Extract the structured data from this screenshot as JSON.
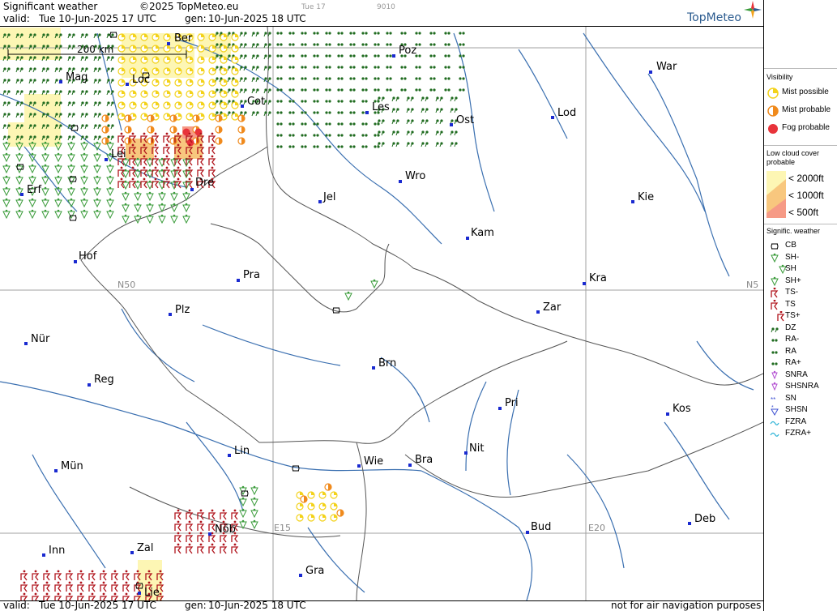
{
  "header": {
    "title": "Significant weather",
    "copyright": "©2025 TopMeteo.eu",
    "valid_label": "valid:",
    "valid_value": "Tue  10-Jun-2025  17 UTC",
    "gen_label": "gen:",
    "gen_value": "10-Jun-2025 18 UTC",
    "ghost_day": "Tue 17",
    "ghost_code": "9010",
    "logo": "TopMeteo"
  },
  "footer": {
    "valid_label": "valid:",
    "valid_value": "Tue  10-Jun-2025  17 UTC",
    "gen_label": "gen:",
    "gen_value": "10-Jun-2025 18 UTC",
    "disclaimer": "not for air navigation purposes"
  },
  "map": {
    "scale_label": "200 km",
    "grid_labels": {
      "n50": "N50",
      "n50_right": "N5",
      "e15": "E15",
      "e20": "E20"
    },
    "cities": [
      {
        "name": "Ber"
      },
      {
        "name": "Poz"
      },
      {
        "name": "War"
      },
      {
        "name": "Mag"
      },
      {
        "name": "Loc"
      },
      {
        "name": "Cot"
      },
      {
        "name": "Les"
      },
      {
        "name": "Ost"
      },
      {
        "name": "Lod"
      },
      {
        "name": "Lei"
      },
      {
        "name": "Erf"
      },
      {
        "name": "Dre"
      },
      {
        "name": "Jel"
      },
      {
        "name": "Wro"
      },
      {
        "name": "Kie"
      },
      {
        "name": "Kam"
      },
      {
        "name": "Hof"
      },
      {
        "name": "Pra"
      },
      {
        "name": "Kra"
      },
      {
        "name": "Zar"
      },
      {
        "name": "Plz"
      },
      {
        "name": "Nür"
      },
      {
        "name": "Brn"
      },
      {
        "name": "Reg"
      },
      {
        "name": "Pri"
      },
      {
        "name": "Kos"
      },
      {
        "name": "Nit"
      },
      {
        "name": "Lin"
      },
      {
        "name": "Wie"
      },
      {
        "name": "Bra"
      },
      {
        "name": "Mün"
      },
      {
        "name": "Nöb"
      },
      {
        "name": "Bud"
      },
      {
        "name": "Deb"
      },
      {
        "name": "Inn"
      },
      {
        "name": "Zal"
      },
      {
        "name": "Gra"
      },
      {
        "name": "Lie"
      }
    ]
  },
  "legend": {
    "visibility_title": "Visibility",
    "visibility": [
      {
        "label": "Mist possible",
        "color": "#f3d21a"
      },
      {
        "label": "Mist probable",
        "color": "#f08a1c"
      },
      {
        "label": "Fog probable",
        "color": "#e8333a"
      }
    ],
    "lowcloud_title_1": "Low cloud cover",
    "lowcloud_title_2": "probable",
    "lowcloud": [
      {
        "label": "< 2000ft",
        "color": "#fdf6b4"
      },
      {
        "label": "< 1000ft",
        "color": "#f8c77e"
      },
      {
        "label": "<   500ft",
        "color": "#f69a86"
      }
    ],
    "sigwx_title": "Signific. weather",
    "sigwx": [
      {
        "label": "CB",
        "icon": "cb-icon"
      },
      {
        "label": "SH-",
        "icon": "shower-light-icon"
      },
      {
        "label": "SH",
        "icon": "shower-icon"
      },
      {
        "label": "SH+",
        "icon": "shower-heavy-icon"
      },
      {
        "label": "TS-",
        "icon": "thunderstorm-light-icon"
      },
      {
        "label": "TS",
        "icon": "thunderstorm-icon"
      },
      {
        "label": "TS+",
        "icon": "thunderstorm-heavy-icon"
      },
      {
        "label": "DZ",
        "icon": "drizzle-icon"
      },
      {
        "label": "RA-",
        "icon": "rain-light-icon"
      },
      {
        "label": "RA",
        "icon": "rain-icon"
      },
      {
        "label": "RA+",
        "icon": "rain-heavy-icon"
      },
      {
        "label": "SNRA",
        "icon": "sleet-icon"
      },
      {
        "label": "SHSNRA",
        "icon": "sleet-shower-icon"
      },
      {
        "label": "SN",
        "icon": "snow-icon"
      },
      {
        "label": "SHSN",
        "icon": "snow-shower-icon"
      },
      {
        "label": "FZRA",
        "icon": "freezing-rain-icon"
      },
      {
        "label": "FZRA+",
        "icon": "freezing-rain-heavy-icon"
      }
    ]
  }
}
